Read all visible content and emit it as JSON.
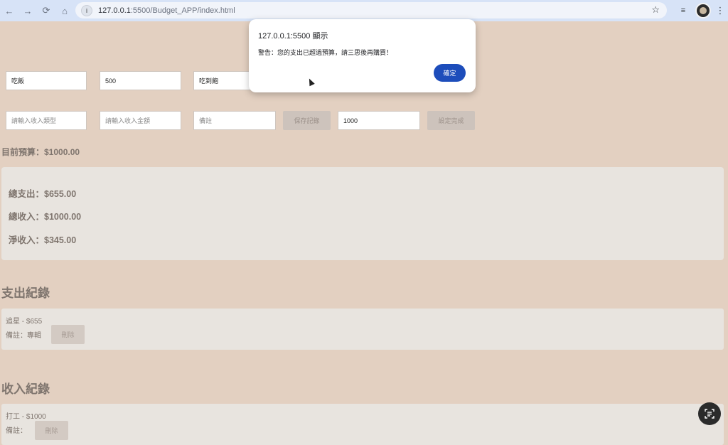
{
  "browser": {
    "url_host": "127.0.0.1",
    "url_path": ":5500/Budget_APP/index.html",
    "nav_icons": [
      "back-icon",
      "forward-icon",
      "reload-icon",
      "home-icon"
    ],
    "bookmark_icon": "star-icon",
    "extension_icon": "playlist-icon",
    "menu_icon": "more-vert-icon"
  },
  "expense_form": {
    "type_value": "吃飯",
    "amount_value": "500",
    "note_value": "吃到飽"
  },
  "income_form": {
    "type_placeholder": "請輸入收入類型",
    "amount_placeholder": "請輸入收入金額",
    "note_placeholder": "備註",
    "save_label": "保存記錄",
    "budget_value": "1000",
    "budget_set_label": "設定完成"
  },
  "budget": {
    "current_text": "目前預算：$1000.00"
  },
  "summary": {
    "total_expense": "總支出：$655.00",
    "total_income": "總收入：$1000.00",
    "net_income": "淨收入：$345.00"
  },
  "expense_records": {
    "title": "支出紀錄",
    "items": [
      {
        "line": "追星 - $655",
        "note": "備註：專輯",
        "delete_label": "刪除"
      }
    ]
  },
  "income_records": {
    "title": "收入紀錄",
    "items": [
      {
        "line": "打工 - $1000",
        "note": "備註：",
        "delete_label": "刪除"
      }
    ]
  },
  "alert": {
    "title": "127.0.0.1:5500 顯示",
    "message": "警告：您的支出已超過預算，請三思後再購買！",
    "ok_label": "確定"
  },
  "colors": {
    "page_bg": "#e3d0c1",
    "card_bg": "#e8e4df",
    "text": "#7f756e",
    "accent": "#1d4dbb"
  }
}
